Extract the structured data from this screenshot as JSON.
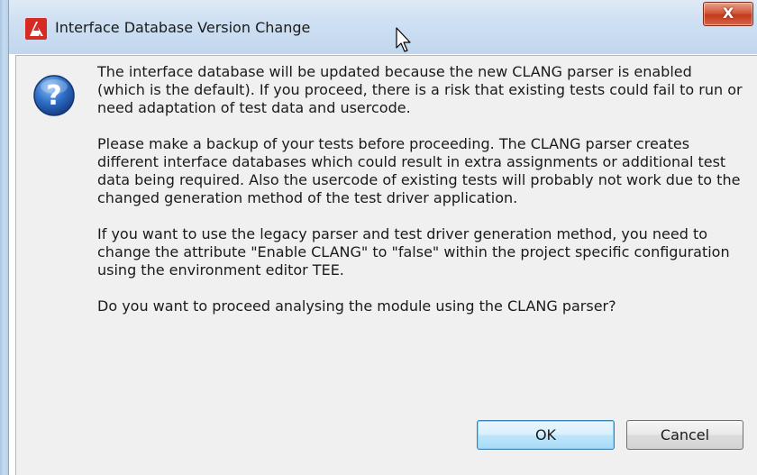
{
  "window": {
    "title": "Interface Database Version Change",
    "close_label": "X"
  },
  "message": {
    "paragraphs": [
      "The interface database will be updated because the new CLANG parser is enabled (which is the default). If you proceed, there is a risk that existing tests could fail to run or need adaptation of test data and usercode.",
      "Please make a backup of your tests before proceeding. The CLANG parser creates different interface databases which could result in extra assignments or additional test data being required. Also the usercode of existing tests will probably not work due to the changed generation method of the test driver application.",
      "If you want to use the legacy parser and test driver generation method, you need to change the attribute \"Enable CLANG\" to \"false\" within the project specific configuration using the environment editor TEE.",
      "Do you want to proceed analysing the module using the CLANG parser?"
    ]
  },
  "buttons": {
    "ok": "OK",
    "cancel": "Cancel"
  },
  "icons": {
    "app": "app-logo-icon",
    "question": "question-icon",
    "cursor": "mouse-cursor-icon"
  },
  "colors": {
    "close_button": "#c8452a",
    "question_icon": "#2a62b8",
    "default_button_border": "#3c7fb1"
  }
}
